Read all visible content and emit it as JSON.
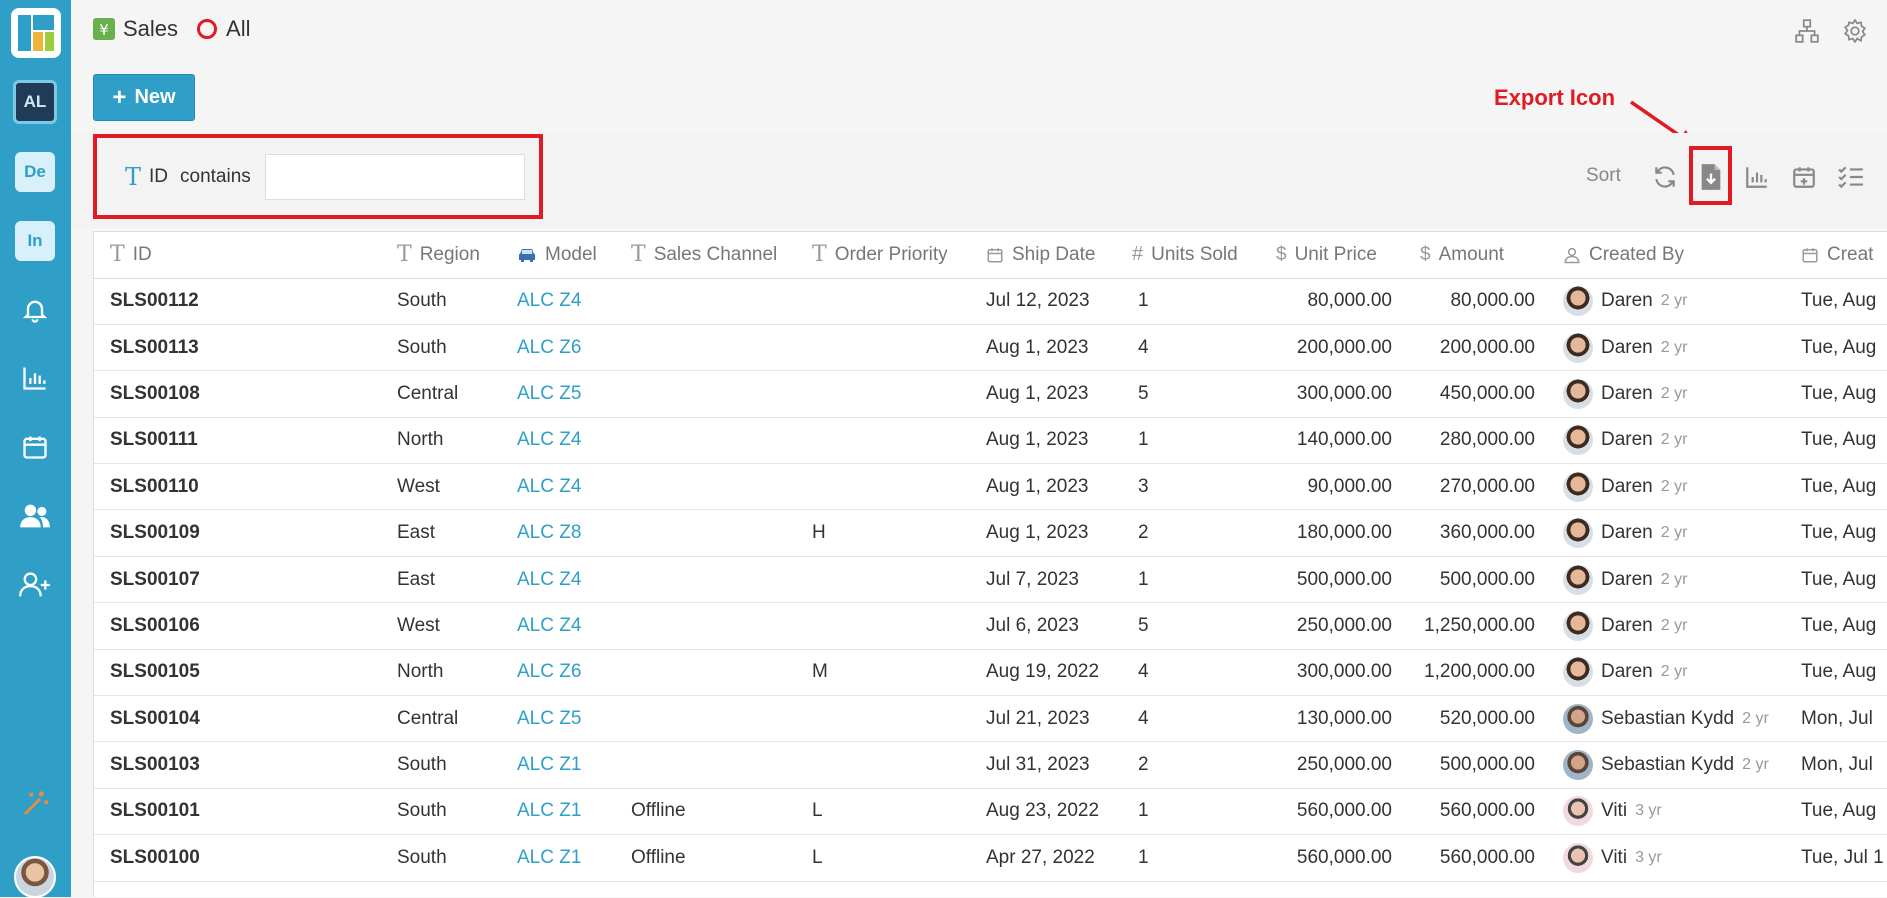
{
  "sidebar": {
    "badges": [
      "AL",
      "De",
      "In"
    ],
    "icons": [
      "bell-icon",
      "chart-icon",
      "calendar-icon",
      "users-icon",
      "add-user-icon",
      "magic-wand-icon"
    ]
  },
  "breadcrumb": {
    "app": "Sales",
    "view": "All"
  },
  "toolbar": {
    "new_label": "New",
    "sort_label": "Sort"
  },
  "filter": {
    "field": "ID",
    "operator": "contains",
    "value": ""
  },
  "annotation": {
    "export_label": "Export Icon"
  },
  "columns": [
    "ID",
    "Region",
    "Model",
    "Sales Channel",
    "Order Priority",
    "Ship Date",
    "Units Sold",
    "Unit Price",
    "Amount",
    "Created By",
    "Creat"
  ],
  "rows": [
    {
      "id": "SLS00112",
      "region": "South",
      "model": "ALC Z4",
      "channel": "",
      "priority": "",
      "ship": "Jul 12, 2023",
      "units": "1",
      "price": "80,000.00",
      "amount": "80,000.00",
      "creator": "Daren",
      "ago": "2 yr",
      "created": "Tue, Aug",
      "av": "daren"
    },
    {
      "id": "SLS00113",
      "region": "South",
      "model": "ALC Z6",
      "channel": "",
      "priority": "",
      "ship": "Aug 1, 2023",
      "units": "4",
      "price": "200,000.00",
      "amount": "200,000.00",
      "creator": "Daren",
      "ago": "2 yr",
      "created": "Tue, Aug",
      "av": "daren"
    },
    {
      "id": "SLS00108",
      "region": "Central",
      "model": "ALC Z5",
      "channel": "",
      "priority": "",
      "ship": "Aug 1, 2023",
      "units": "5",
      "price": "300,000.00",
      "amount": "450,000.00",
      "creator": "Daren",
      "ago": "2 yr",
      "created": "Tue, Aug",
      "av": "daren"
    },
    {
      "id": "SLS00111",
      "region": "North",
      "model": "ALC Z4",
      "channel": "",
      "priority": "",
      "ship": "Aug 1, 2023",
      "units": "1",
      "price": "140,000.00",
      "amount": "280,000.00",
      "creator": "Daren",
      "ago": "2 yr",
      "created": "Tue, Aug",
      "av": "daren"
    },
    {
      "id": "SLS00110",
      "region": "West",
      "model": "ALC Z4",
      "channel": "",
      "priority": "",
      "ship": "Aug 1, 2023",
      "units": "3",
      "price": "90,000.00",
      "amount": "270,000.00",
      "creator": "Daren",
      "ago": "2 yr",
      "created": "Tue, Aug",
      "av": "daren"
    },
    {
      "id": "SLS00109",
      "region": "East",
      "model": "ALC Z8",
      "channel": "",
      "priority": "H",
      "ship": "Aug 1, 2023",
      "units": "2",
      "price": "180,000.00",
      "amount": "360,000.00",
      "creator": "Daren",
      "ago": "2 yr",
      "created": "Tue, Aug",
      "av": "daren"
    },
    {
      "id": "SLS00107",
      "region": "East",
      "model": "ALC Z4",
      "channel": "",
      "priority": "",
      "ship": "Jul 7, 2023",
      "units": "1",
      "price": "500,000.00",
      "amount": "500,000.00",
      "creator": "Daren",
      "ago": "2 yr",
      "created": "Tue, Aug",
      "av": "daren"
    },
    {
      "id": "SLS00106",
      "region": "West",
      "model": "ALC Z4",
      "channel": "",
      "priority": "",
      "ship": "Jul 6, 2023",
      "units": "5",
      "price": "250,000.00",
      "amount": "1,250,000.00",
      "creator": "Daren",
      "ago": "2 yr",
      "created": "Tue, Aug",
      "av": "daren"
    },
    {
      "id": "SLS00105",
      "region": "North",
      "model": "ALC Z6",
      "channel": "",
      "priority": "M",
      "ship": "Aug 19, 2022",
      "units": "4",
      "price": "300,000.00",
      "amount": "1,200,000.00",
      "creator": "Daren",
      "ago": "2 yr",
      "created": "Tue, Aug",
      "av": "daren"
    },
    {
      "id": "SLS00104",
      "region": "Central",
      "model": "ALC Z5",
      "channel": "",
      "priority": "",
      "ship": "Jul 21, 2023",
      "units": "4",
      "price": "130,000.00",
      "amount": "520,000.00",
      "creator": "Sebastian Kydd",
      "ago": "2 yr",
      "created": "Mon, Jul",
      "av": "seb"
    },
    {
      "id": "SLS00103",
      "region": "South",
      "model": "ALC Z1",
      "channel": "",
      "priority": "",
      "ship": "Jul 31, 2023",
      "units": "2",
      "price": "250,000.00",
      "amount": "500,000.00",
      "creator": "Sebastian Kydd",
      "ago": "2 yr",
      "created": "Mon, Jul",
      "av": "seb"
    },
    {
      "id": "SLS00101",
      "region": "South",
      "model": "ALC Z1",
      "channel": "Offline",
      "priority": "L",
      "ship": "Aug 23, 2022",
      "units": "1",
      "price": "560,000.00",
      "amount": "560,000.00",
      "creator": "Viti",
      "ago": "3 yr",
      "created": "Tue, Aug",
      "av": "viti"
    },
    {
      "id": "SLS00100",
      "region": "South",
      "model": "ALC Z1",
      "channel": "Offline",
      "priority": "L",
      "ship": "Apr 27, 2022",
      "units": "1",
      "price": "560,000.00",
      "amount": "560,000.00",
      "creator": "Viti",
      "ago": "3 yr",
      "created": "Tue, Jul 1",
      "av": "viti"
    }
  ]
}
